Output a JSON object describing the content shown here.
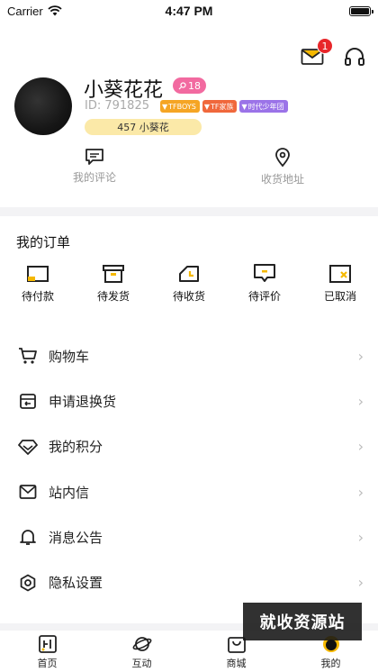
{
  "status": {
    "carrier": "Carrier",
    "time": "4:47 PM"
  },
  "header": {
    "message_badge": "1"
  },
  "profile": {
    "nickname": "小葵花花",
    "level": "18",
    "uid": "ID:  791825",
    "tags": [
      {
        "label": "TFBOYS",
        "color": "#f5a524"
      },
      {
        "label": "TF家族",
        "color": "#f0683c"
      },
      {
        "label": "时代少年团",
        "color": "#9b73e8"
      }
    ],
    "fans": "457 小葵花"
  },
  "quick_links": [
    {
      "label": "我的评论",
      "icon": "comment-icon"
    },
    {
      "label": "收货地址",
      "icon": "location-pin-icon"
    }
  ],
  "orders": {
    "title": "我的订单",
    "items": [
      {
        "label": "待付款",
        "icon": "wallet-icon"
      },
      {
        "label": "待发货",
        "icon": "box-icon"
      },
      {
        "label": "待收货",
        "icon": "truck-icon"
      },
      {
        "label": "待评价",
        "icon": "review-icon"
      },
      {
        "label": "已取消",
        "icon": "cancelled-icon"
      }
    ]
  },
  "menu": [
    {
      "label": "购物车",
      "icon": "cart-icon"
    },
    {
      "label": "申请退换货",
      "icon": "return-icon"
    },
    {
      "label": "我的积分",
      "icon": "diamond-icon"
    },
    {
      "label": "站内信",
      "icon": "mail-icon"
    },
    {
      "label": "消息公告",
      "icon": "bell-icon"
    },
    {
      "label": "隐私设置",
      "icon": "settings-icon"
    }
  ],
  "tabs": [
    {
      "label": "首页",
      "icon": "home-icon"
    },
    {
      "label": "互动",
      "icon": "planet-icon"
    },
    {
      "label": "商城",
      "icon": "shop-icon"
    },
    {
      "label": "我的",
      "icon": "profile-icon"
    }
  ],
  "watermark": "就收资源站",
  "colors": {
    "accent_yellow": "#f5b800",
    "badge_red": "#e8262a",
    "level_pink": "#f26aa0",
    "fans_bg": "#fbe9a8"
  }
}
